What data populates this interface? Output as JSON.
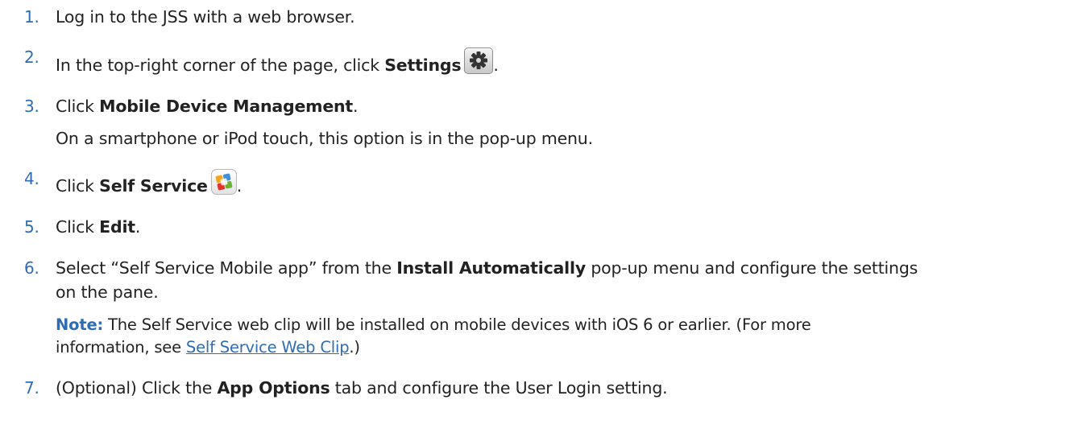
{
  "steps": [
    {
      "num": "1.",
      "text": "Log in to the JSS with a web browser."
    },
    {
      "num": "2.",
      "pre": "In the top-right corner of the page, click ",
      "bold": "Settings",
      "post": ".",
      "icon": "gear-icon"
    },
    {
      "num": "3.",
      "pre": "Click ",
      "bold": "Mobile Device Management",
      "post": ".",
      "sub": "On a smartphone or iPod touch, this option is in the pop-up menu."
    },
    {
      "num": "4.",
      "pre": "Click ",
      "bold": "Self Service",
      "post": ".",
      "icon": "self-service-icon"
    },
    {
      "num": "5.",
      "pre": "Click ",
      "bold": "Edit",
      "post": "."
    },
    {
      "num": "6.",
      "pre": "Select “Self Service Mobile app” from the ",
      "bold": "Install Automatically",
      "post_line1": " pop-up menu and configure the settings",
      "line2": "on the pane.",
      "note_label": "Note:",
      "note_text": " The Self Service web clip will be installed on mobile devices with iOS 6 or earlier. (For more",
      "note_line2_pre": "information, see ",
      "note_link": "Self Service Web Clip",
      "note_line2_post": ".)"
    },
    {
      "num": "7.",
      "pre": "(Optional) Click the ",
      "bold": "App Options",
      "post": " tab and configure the User Login setting."
    }
  ],
  "colors": {
    "number": "#2e6db3",
    "text": "#222222",
    "link": "#2e6db3"
  }
}
